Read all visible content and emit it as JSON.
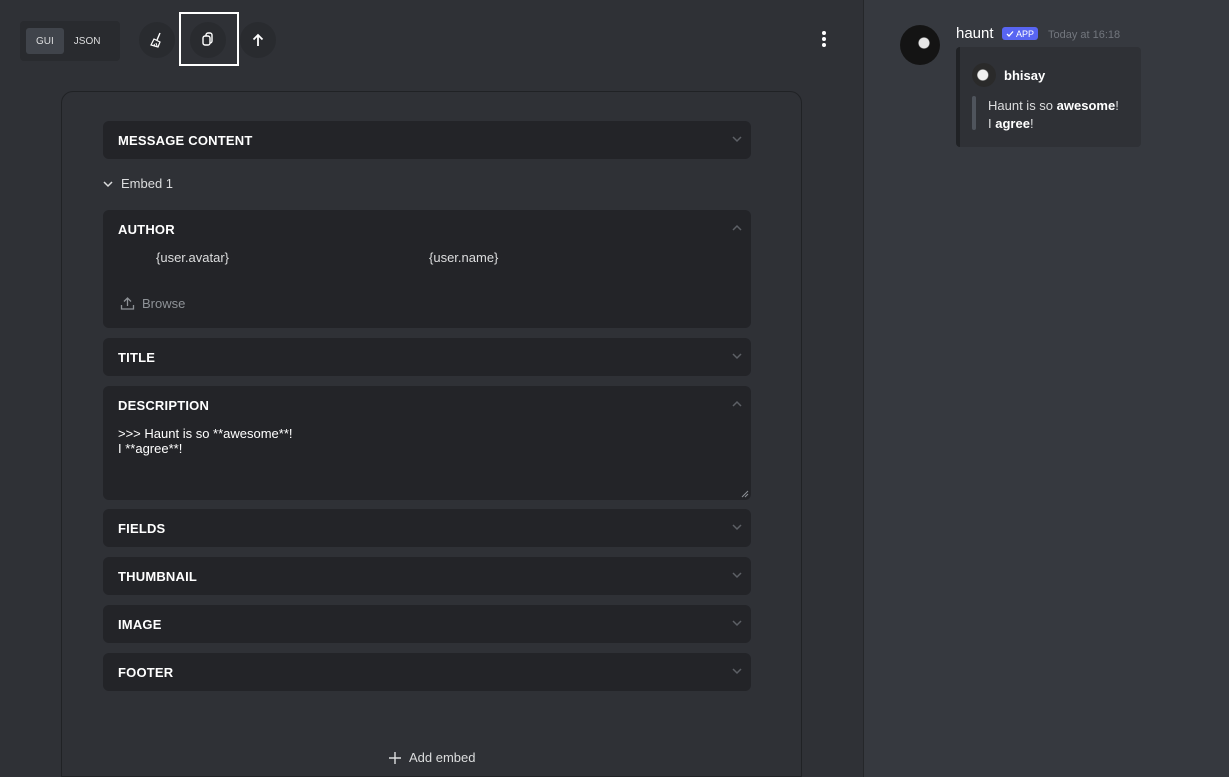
{
  "toolbar": {
    "mode_gui": "GUI",
    "mode_json": "JSON",
    "clear_icon": "broom-icon",
    "copy_icon": "copy-icon",
    "send_icon": "arrow-up-icon",
    "menu_icon": "kebab-menu-icon"
  },
  "editor": {
    "sections": {
      "message_content": "MESSAGE CONTENT",
      "author": "AUTHOR",
      "title": "TITLE",
      "description": "DESCRIPTION",
      "fields": "FIELDS",
      "thumbnail": "THUMBNAIL",
      "image": "IMAGE",
      "footer": "FOOTER"
    },
    "embed_label": "Embed 1",
    "author": {
      "icon_value": "{user.avatar}",
      "name_value": "{user.name}",
      "browse_label": "Browse"
    },
    "description_value": ">>> Haunt is so **awesome**!\nI **agree**!",
    "add_embed_label": "Add embed"
  },
  "preview": {
    "bot_name": "haunt",
    "badge": "APP",
    "timestamp": "Today at 16:18",
    "embed": {
      "author": "bhisay",
      "line1_prefix": "Haunt is so ",
      "line1_bold": "awesome",
      "line1_suffix": "!",
      "line2_prefix": "I ",
      "line2_bold": "agree",
      "line2_suffix": "!"
    }
  },
  "colors": {
    "background": "#2f3136",
    "section_bg": "#232428",
    "preview_bg": "#36393f",
    "accent": "#5865f2"
  }
}
